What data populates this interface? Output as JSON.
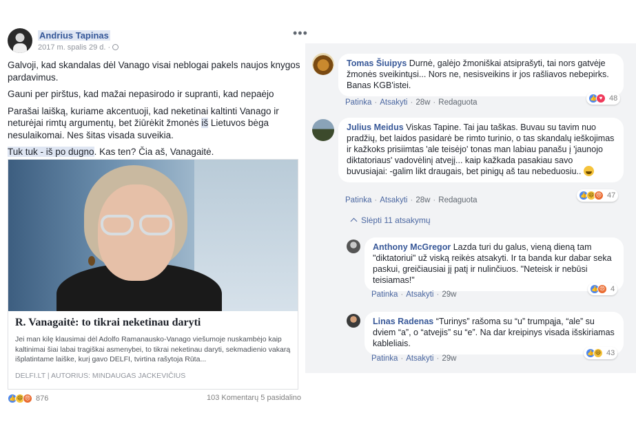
{
  "post": {
    "author": "Andrius Tapinas",
    "date": "2017 m. spalis 29 d. ·",
    "more": "•••",
    "paragraphs": [
      "Galvoji, kad skandalas dėl Vanago visai neblogai pakels naujos knygos pardavimus.",
      "Gauni per pirštus, kad mažai nepasirodo ir supranti, kad nepaėjo"
    ],
    "para3_a": "Parašai laišką, kuriame akcentuoji, kad neketinai kaltinti Vanago ir neturėjai rimtų argumentų, bet žiūrėkit žmonės ",
    "para3_hl": "iš",
    "para3_b": " Lietuvos bėga nesulaikomai. Nes šitas visada suveikia.",
    "para4_hl": "Tuk tuk - iš po dugno",
    "para4_b": ". Kas ten? Čia aš, Vanagaitė.",
    "link": {
      "title": "R. Vanagaitė: to tikrai neketinau daryti",
      "description": "Jei man kilę klausimai dėl Adolfo Ramanausko-Vanago viešumoje nuskambėjo kaip kaltinimai šiai labai tragiškai asmenybei, to tikrai neketinau daryti, sekmadienio vakarą išplatintame laiške, kurį gavo DELFI, tvirtina rašytoja Rūta...",
      "source": "DELFI.LT | AUTORIUS: MINDAUGAS JACKEVIČIUS"
    },
    "footer": {
      "reaction_count": "876",
      "comments": "103 Komentarų",
      "shares": "5 pasidalino"
    }
  },
  "comments": [
    {
      "name": "Tomas Šiuipys",
      "text": "Durnė, galėjo žmoniškai atsiprašyti, tai nors gatvėje žmonės sveikintųsi... Nors ne, nesisveikins ir jos rašliavos nebepirks. Banas KGB'istei.",
      "like": "Patinka",
      "reply": "Atsakyti",
      "time": "28w",
      "edited": "Redaguota",
      "reaction_count": "48"
    },
    {
      "name": "Julius Meidus",
      "text": "Viskas Tapine. Tai jau taškas. Buvau su tavim nuo pradžių, bet laidos pasidarė be rimto turinio, o tas skandalų ieškojimas ir kažkoks prisiimtas 'ale teisėjo' tonas man labiau panašu į 'jaunojo diktatoriaus' vadovėlinį atvejį... kaip kažkada pasakiau savo buvusiajai: -galim likt draugais, bet pinigų aš tau nebeduosiu..",
      "like": "Patinka",
      "reply": "Atsakyti",
      "time": "28w",
      "edited": "Redaguota",
      "reaction_count": "47"
    }
  ],
  "hide_replies": "Slėpti 11 atsakymų",
  "replies": [
    {
      "name": "Anthony McGregor",
      "text": "Lazda turi du galus, vieną dieną tam \"diktatoriui\" už viską reikės atsakyti. Ir ta banda kur dabar seka paskui, greičiausiai jį patį ir nulinčiuos. \"Neteisk ir nebūsi teisiamas!\"",
      "like": "Patinka",
      "reply": "Atsakyti",
      "time": "29w",
      "reaction_count": "4"
    },
    {
      "name": "Linas Radenas",
      "text": "“Turinys” rašoma su “u” trumpąja, “ale” su dviem “a”, o “atvejis” su “e”. Na dar kreipinys visada išskiriamas kableliais.",
      "like": "Patinka",
      "reply": "Atsakyti",
      "time": "29w",
      "reaction_count": "43"
    }
  ],
  "colors": {
    "link_blue": "#385898",
    "panel_bg": "#f2f3f5",
    "like_blue": "#4c87ef",
    "haha_yellow": "#f5c33b",
    "angry_orange": "#ea6a2f",
    "love_red": "#f0395a"
  }
}
